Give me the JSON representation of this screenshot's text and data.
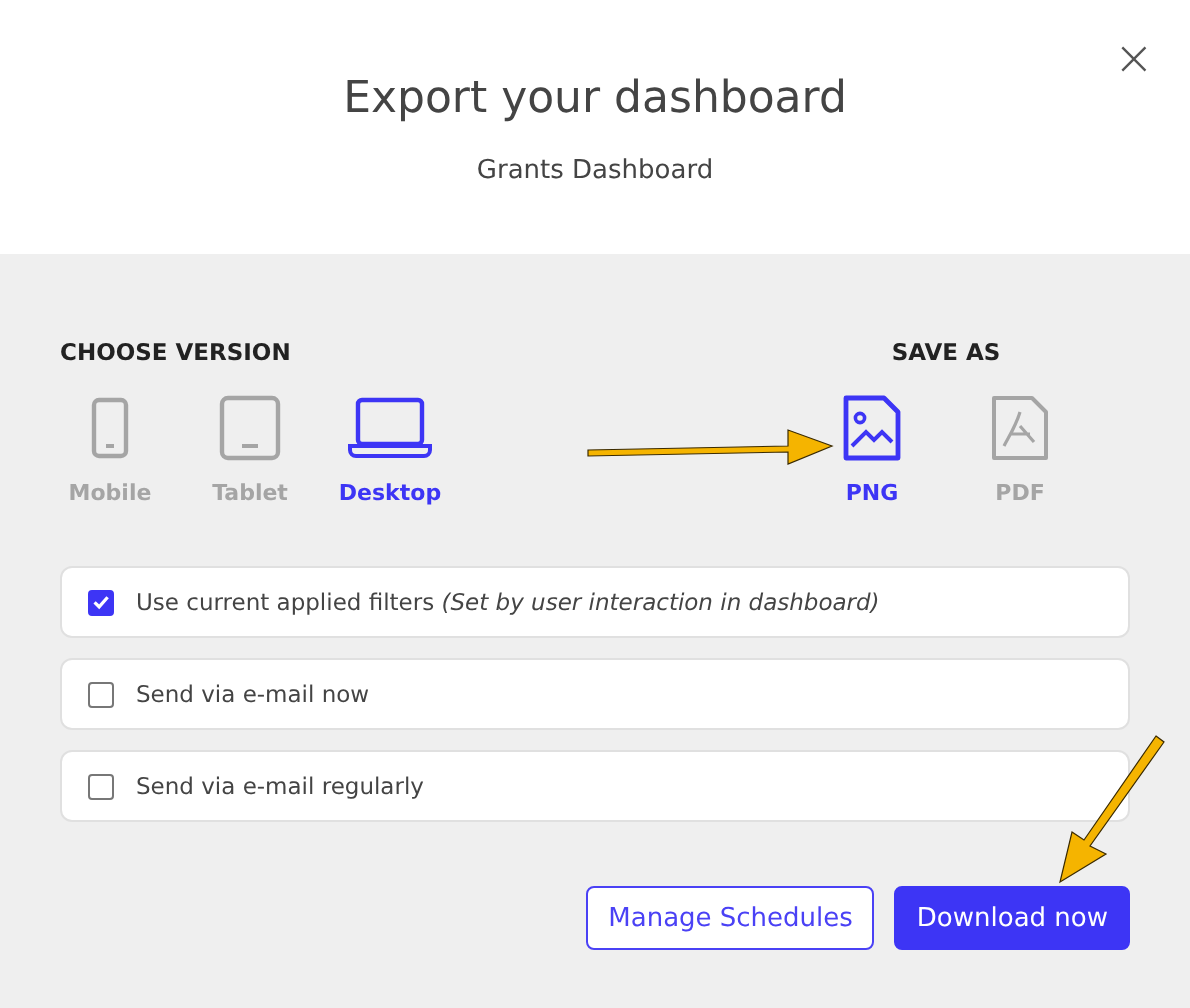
{
  "dialog": {
    "title": "Export your dashboard",
    "subtitle": "Grants Dashboard",
    "close": "×"
  },
  "version": {
    "heading": "CHOOSE VERSION",
    "options": [
      {
        "kind": "mobile",
        "label": "Mobile",
        "selected": false
      },
      {
        "kind": "tablet",
        "label": "Tablet",
        "selected": false
      },
      {
        "kind": "desktop",
        "label": "Desktop",
        "selected": true
      }
    ]
  },
  "save_as": {
    "heading": "SAVE AS",
    "options": [
      {
        "kind": "png",
        "label": "PNG",
        "selected": true
      },
      {
        "kind": "pdf",
        "label": "PDF",
        "selected": false
      }
    ]
  },
  "options": [
    {
      "label": "Use current applied filters *(Set by user interaction in dashboard)*",
      "checked": true
    },
    {
      "label": "Send via e-mail now",
      "checked": false
    },
    {
      "label": "Send via e-mail regularly",
      "checked": false
    }
  ],
  "buttons": [
    {
      "label": "Manage Schedules",
      "kind": "secondary"
    },
    {
      "label": "Download now",
      "kind": "primary"
    }
  ]
}
